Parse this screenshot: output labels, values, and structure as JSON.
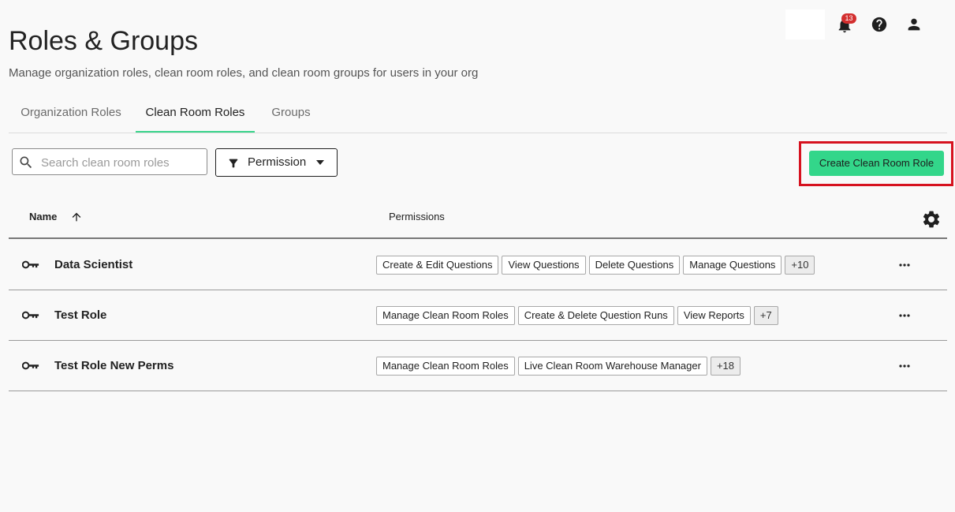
{
  "header": {
    "notification_count": "13",
    "icons": [
      "bell-icon",
      "help-icon",
      "user-icon"
    ]
  },
  "page": {
    "title": "Roles & Groups",
    "subtitle": "Manage organization roles, clean room roles, and clean room groups for users in your org"
  },
  "tabs": [
    {
      "label": "Organization Roles",
      "active": false
    },
    {
      "label": "Clean Room Roles",
      "active": true
    },
    {
      "label": "Groups",
      "active": false
    }
  ],
  "toolbar": {
    "search_placeholder": "Search clean room roles",
    "search_value": "",
    "filter_label": "Permission",
    "create_label": "Create Clean Room Role"
  },
  "table": {
    "columns": [
      "Name",
      "Permissions"
    ],
    "rows": [
      {
        "name": "Data Scientist",
        "permissions": [
          "Create & Edit Questions",
          "View Questions",
          "Delete Questions",
          "Manage Questions"
        ],
        "more": "+10"
      },
      {
        "name": "Test Role",
        "permissions": [
          "Manage Clean Room Roles",
          "Create & Delete Question Runs",
          "View Reports"
        ],
        "more": "+7"
      },
      {
        "name": "Test Role New Perms",
        "permissions": [
          "Manage Clean Room Roles",
          "Live Clean Room Warehouse Manager"
        ],
        "more": "+18"
      }
    ]
  },
  "colors": {
    "accent": "#33d68a",
    "highlight_box": "#d6121f",
    "badge": "#d32f2f"
  }
}
